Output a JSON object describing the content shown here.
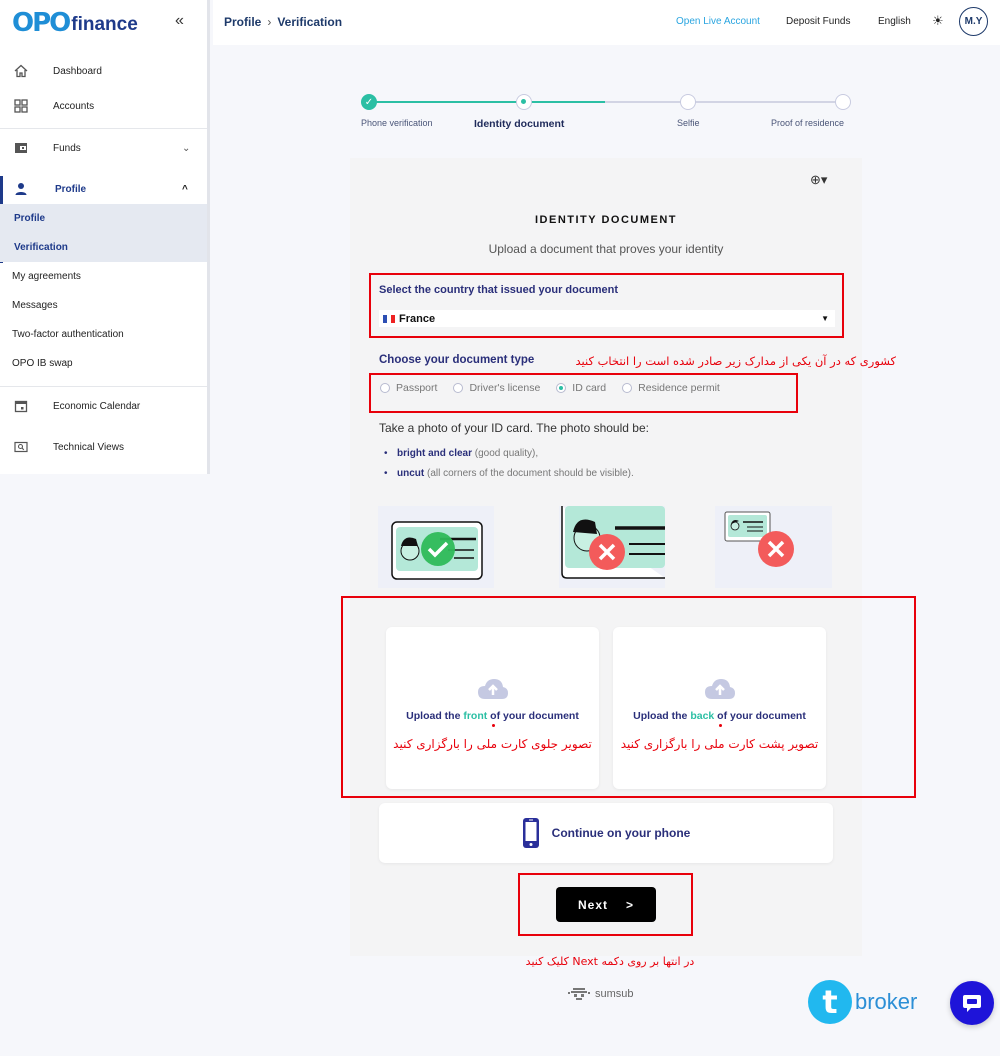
{
  "sidebar": {
    "logo_mark": "OPO",
    "logo_text": "finance",
    "collapse_icon": "double-chevron-left-icon",
    "items": [
      {
        "label": "Dashboard",
        "icon": "home-icon"
      },
      {
        "label": "Accounts",
        "icon": "grid-icon"
      },
      {
        "label": "Funds",
        "icon": "wallet-icon"
      },
      {
        "label": "Profile",
        "icon": "user-icon"
      }
    ],
    "profile_subitems": [
      {
        "label": "Profile"
      },
      {
        "label": "Verification"
      },
      {
        "label": "My agreements"
      },
      {
        "label": "Messages"
      },
      {
        "label": "Two-factor authentication"
      },
      {
        "label": "OPO IB swap"
      }
    ],
    "bottom_items": [
      {
        "label": "Economic Calendar",
        "icon": "calendar-icon"
      },
      {
        "label": "Technical Views",
        "icon": "search-chart-icon"
      }
    ]
  },
  "topbar": {
    "breadcrumb": [
      "Profile",
      "Verification"
    ],
    "open_live_account": "Open Live Account",
    "deposit_funds": "Deposit Funds",
    "language": "English",
    "avatar_initials": "M.Y"
  },
  "stepper": {
    "steps": [
      {
        "label": "Phone verification",
        "state": "done"
      },
      {
        "label": "Identity document",
        "state": "current"
      },
      {
        "label": "Selfie",
        "state": "pending"
      },
      {
        "label": "Proof of residence",
        "state": "pending"
      }
    ]
  },
  "card": {
    "title": "IDENTITY DOCUMENT",
    "subtitle": "Upload a document that proves your identity",
    "country_label": "Select the country that issued your document",
    "country_value": "France",
    "doctype_label": "Choose your document type",
    "doctype_note_fa": "کشوری که در آن یکی از مدارک زیر صادر شده است را انتخاب کنید",
    "doc_types": [
      {
        "label": "Passport",
        "selected": false
      },
      {
        "label": "Driver's license",
        "selected": false
      },
      {
        "label": "ID card",
        "selected": true
      },
      {
        "label": "Residence permit",
        "selected": false
      }
    ],
    "photo_instruction": "Take a photo of your ID card. The photo should be:",
    "requirements": [
      {
        "bold": "bright and clear",
        "rest": " (good quality),"
      },
      {
        "bold": "uncut",
        "rest": " (all corners of the document should be visible)."
      }
    ],
    "upload_front": {
      "prefix": "Upload the ",
      "highlight": "front",
      "suffix": " of your document",
      "note_fa": "تصویر جلوی کارت ملی را بارگزاری کنید"
    },
    "upload_back": {
      "prefix": "Upload the ",
      "highlight": "back",
      "suffix": " of your document",
      "note_fa": "تصویر پشت کارت ملی را بارگزاری کنید"
    },
    "continue_phone": "Continue on your phone",
    "next_label": "Next",
    "next_arrow": ">"
  },
  "footer": {
    "next_note_fa": "در انتها بر روی دکمه Next کلیک کنید",
    "powered_by": "sumsub",
    "watermark_t": "t",
    "watermark_text": "broker"
  },
  "colors": {
    "accent": "#2bbfa4",
    "brand": "#1e3a8a",
    "annotation_red": "#e8000b",
    "chat": "#1e14d9"
  }
}
